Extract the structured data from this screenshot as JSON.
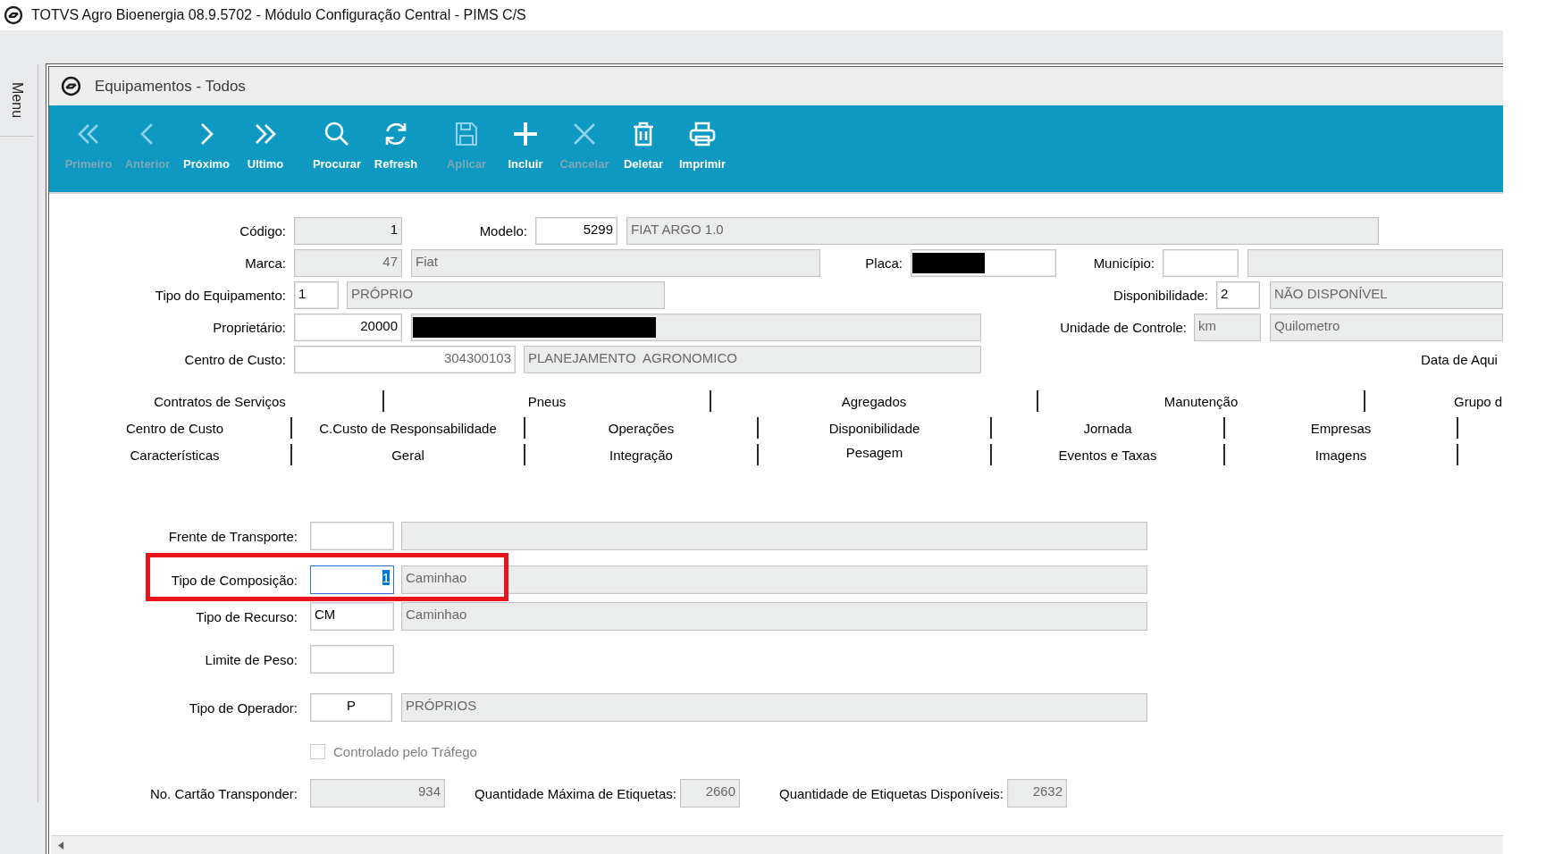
{
  "app": {
    "title": "TOTVS Agro Bioenergia 08.9.5702 - Módulo Configuração Central - PIMS C/S"
  },
  "side_menu": {
    "label": "Menu"
  },
  "window": {
    "title": "Equipamentos - Todos"
  },
  "toolbar": [
    {
      "kind": "first",
      "label": "Primeiro",
      "disabled": true
    },
    {
      "kind": "previous",
      "label": "Anterior",
      "disabled": true
    },
    {
      "kind": "next",
      "label": "Próximo",
      "disabled": false
    },
    {
      "kind": "last",
      "label": "Ultimo",
      "disabled": false
    },
    {
      "kind": "search",
      "label": "Procurar",
      "disabled": false
    },
    {
      "kind": "refresh",
      "label": "Refresh",
      "disabled": false
    },
    {
      "kind": "save",
      "label": "Aplicar",
      "disabled": true
    },
    {
      "kind": "add",
      "label": "Incluir",
      "disabled": false
    },
    {
      "kind": "cancel",
      "label": "Cancelar",
      "disabled": true
    },
    {
      "kind": "delete",
      "label": "Deletar",
      "disabled": false
    },
    {
      "kind": "print",
      "label": "Imprimir",
      "disabled": false
    }
  ],
  "header_form": [
    [
      {
        "label": "Código:",
        "fields": [
          {
            "value": "1",
            "readonly": true,
            "disabled": false,
            "focused": false,
            "redacted": false
          }
        ]
      },
      {
        "label": "Modelo:",
        "fields": [
          {
            "value": "5299",
            "readonly": false,
            "disabled": false,
            "focused": false,
            "redacted": false
          },
          {
            "value": "FIAT ARGO 1.0",
            "readonly": true,
            "disabled": true,
            "focused": false,
            "redacted": false
          }
        ]
      }
    ],
    [
      {
        "label": "Marca:",
        "fields": [
          {
            "value": "47",
            "readonly": true,
            "disabled": true,
            "focused": false,
            "redacted": false
          },
          {
            "value": "Fiat",
            "readonly": true,
            "disabled": true,
            "focused": false,
            "redacted": false
          }
        ]
      },
      {
        "label": "Placa:",
        "fields": [
          {
            "readonly": false,
            "focused": false,
            "redacted": true
          }
        ]
      },
      {
        "label": "Município:",
        "fields": [
          {
            "readonly": false,
            "focused": false,
            "redacted": false
          },
          {
            "readonly": true,
            "focused": false,
            "redacted": false
          }
        ]
      }
    ],
    [
      {
        "label": "Tipo do Equipamento:",
        "fields": [
          {
            "value": "1",
            "readonly": false,
            "disabled": false,
            "focused": false,
            "redacted": false
          },
          {
            "value": "PRÓPRIO",
            "readonly": true,
            "disabled": true,
            "focused": false,
            "redacted": false
          }
        ]
      },
      {
        "label": "Disponibilidade:",
        "fields": [
          {
            "value": "2",
            "readonly": false,
            "disabled": false,
            "focused": false,
            "redacted": false
          },
          {
            "value": "NÃO DISPONÍVEL",
            "readonly": true,
            "disabled": true,
            "focused": false,
            "redacted": false
          }
        ]
      }
    ],
    [
      {
        "label": "Proprietário:",
        "fields": [
          {
            "value": "20000",
            "readonly": false,
            "disabled": false,
            "focused": false,
            "redacted": false
          },
          {
            "readonly": true,
            "focused": false,
            "redacted": true
          }
        ]
      },
      {
        "label": "Unidade de Controle:",
        "fields": [
          {
            "value": "km",
            "readonly": true,
            "disabled": true,
            "focused": false,
            "redacted": false
          },
          {
            "value": "Quilometro",
            "readonly": true,
            "disabled": true,
            "focused": false,
            "redacted": false
          }
        ]
      }
    ],
    [
      {
        "label": "Centro de Custo:",
        "fields": [
          {
            "value": "304300103",
            "readonly": false,
            "disabled": true,
            "focused": false,
            "redacted": false
          },
          {
            "value": "PLANEJAMENTO  AGRONOMICO",
            "readonly": true,
            "disabled": true,
            "focused": false,
            "redacted": false
          }
        ]
      },
      {
        "label": "Data de Aqui"
      }
    ]
  ],
  "tabs": [
    [
      {
        "label": "Contratos de Serviços",
        "selected": false
      },
      {
        "label": "Pneus",
        "selected": false
      },
      {
        "label": "Agregados",
        "selected": false
      },
      {
        "label": "Manutenção",
        "selected": false
      },
      {
        "label": "Grupo d",
        "selected": false
      }
    ],
    [
      {
        "label": "Centro de Custo",
        "selected": false
      },
      {
        "label": "C.Custo de Responsabilidade",
        "selected": false
      },
      {
        "label": "Operações",
        "selected": false
      },
      {
        "label": "Disponibilidade",
        "selected": false
      },
      {
        "label": "Jornada",
        "selected": false
      },
      {
        "label": "Empresas",
        "selected": false
      }
    ],
    [
      {
        "label": "Características",
        "selected": false
      },
      {
        "label": "Geral",
        "selected": false
      },
      {
        "label": "Integração",
        "selected": false
      },
      {
        "label": "Pesagem",
        "selected": true
      },
      {
        "label": "Eventos e Taxas",
        "selected": false
      },
      {
        "label": "Imagens",
        "selected": false
      }
    ]
  ],
  "detail_form": [
    {
      "kind": "fields",
      "highlighted": false,
      "groups": [
        {
          "label": "Frente de Transporte:",
          "fields": [
            {
              "readonly": false,
              "focused": false,
              "redacted": false
            },
            {
              "readonly": true,
              "focused": false,
              "redacted": false
            }
          ]
        }
      ]
    },
    {
      "kind": "fields",
      "highlighted": true,
      "groups": [
        {
          "label": "Tipo de Composição:",
          "fields": [
            {
              "value": "1",
              "readonly": false,
              "disabled": false,
              "focused": true,
              "redacted": false
            },
            {
              "value": "Caminhao",
              "readonly": true,
              "disabled": true,
              "focused": false,
              "redacted": false
            }
          ]
        }
      ]
    },
    {
      "kind": "fields",
      "highlighted": false,
      "groups": [
        {
          "label": "Tipo de Recurso:",
          "fields": [
            {
              "value": "CM",
              "readonly": false,
              "disabled": false,
              "focused": false,
              "redacted": false
            },
            {
              "value": "Caminhao",
              "readonly": true,
              "disabled": true,
              "focused": false,
              "redacted": false
            }
          ]
        }
      ]
    },
    {
      "kind": "fields",
      "highlighted": false,
      "groups": [
        {
          "label": "Limite de Peso:",
          "fields": [
            {
              "readonly": false,
              "focused": false,
              "redacted": false
            }
          ]
        }
      ]
    },
    {
      "kind": "fields",
      "highlighted": false,
      "groups": [
        {
          "label": "Tipo de Operador:",
          "fields": [
            {
              "value": "P",
              "readonly": false,
              "disabled": false,
              "focused": false,
              "redacted": false
            },
            {
              "value": "PRÓPRIOS",
              "readonly": true,
              "disabled": true,
              "focused": false,
              "redacted": false
            }
          ]
        }
      ]
    },
    {
      "kind": "checkbox",
      "highlighted": false,
      "label": "Controlado pelo Tráfego",
      "checked": false,
      "disabled": true
    },
    {
      "kind": "fields",
      "highlighted": false,
      "groups": [
        {
          "label": "No. Cartão Transponder:",
          "fields": [
            {
              "value": "934",
              "readonly": true,
              "disabled": true,
              "focused": false,
              "redacted": false
            }
          ]
        },
        {
          "label": "Quantidade Máxima de Etiquetas:",
          "fields": [
            {
              "value": "2660",
              "readonly": true,
              "disabled": true,
              "focused": false,
              "redacted": false
            }
          ]
        },
        {
          "label": "Quantidade de Etiquetas Disponíveis:",
          "fields": [
            {
              "value": "2632",
              "readonly": true,
              "disabled": true,
              "focused": false,
              "redacted": false
            }
          ]
        }
      ]
    }
  ]
}
